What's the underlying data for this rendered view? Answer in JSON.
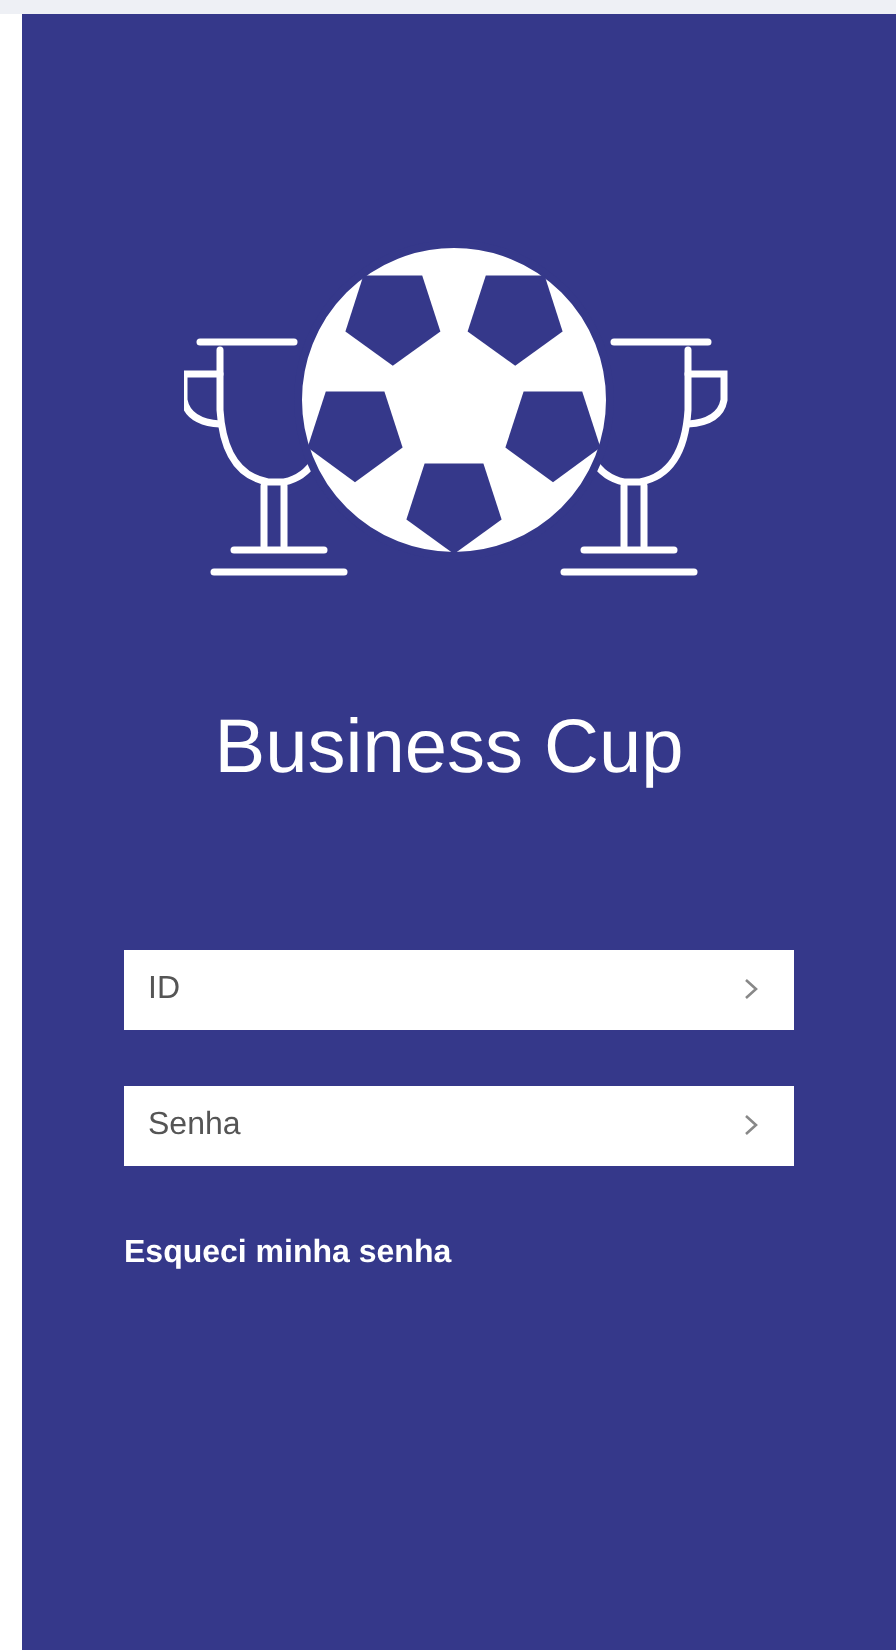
{
  "app": {
    "title": "Business Cup"
  },
  "fields": [
    {
      "placeholder": "ID"
    },
    {
      "placeholder": "Senha"
    }
  ],
  "forgot_link": "Esqueci minha senha"
}
